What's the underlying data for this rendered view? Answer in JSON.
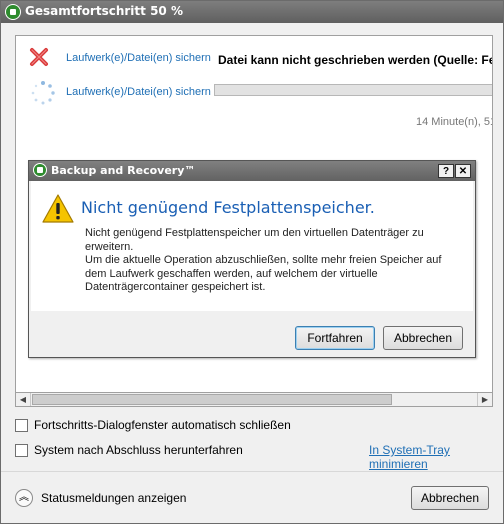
{
  "window": {
    "title": "Gesamtfortschritt 50 %",
    "app_icon": "backup-app-icon"
  },
  "jobs": [
    {
      "label": "Laufwerk(e)/Datei(en) sichern",
      "status": "error",
      "message": "Datei kann nicht geschrieben werden (Quelle: Fe"
    },
    {
      "label": "Laufwerk(e)/Datei(en) sichern",
      "status": "in-progress",
      "progress": 0.0,
      "time_remaining": "14 Minute(n), 51"
    }
  ],
  "options": {
    "auto_close_label": "Fortschritts-Dialogfenster automatisch schließen",
    "auto_close_checked": false,
    "shutdown_label": "System nach Abschluss herunterfahren",
    "shutdown_checked": false,
    "tray_link": "In System-Tray minimieren"
  },
  "footer": {
    "status_toggle_label": "Statusmeldungen anzeigen",
    "cancel_label": "Abbrechen"
  },
  "dialog": {
    "title": "Backup and Recovery™",
    "help_glyph": "?",
    "close_glyph": "✕",
    "heading": "Nicht genügend Festplattenspeicher.",
    "message_line1": "Nicht genügend Festplattenspeicher um den virtuellen Datenträger zu erweitern.",
    "message_line2": "Um die aktuelle Operation abzuschließen, sollte mehr freien Speicher auf dem Laufwerk geschaffen werden, auf welchem der virtuelle Datenträgercontainer gespeichert ist.",
    "continue_label": "Fortfahren",
    "cancel_label": "Abbrechen"
  },
  "colors": {
    "link_blue": "#1f6fb5",
    "heading_blue": "#1a5fb4",
    "error_red": "#d93a3a",
    "warning_yellow": "#f5c400"
  }
}
